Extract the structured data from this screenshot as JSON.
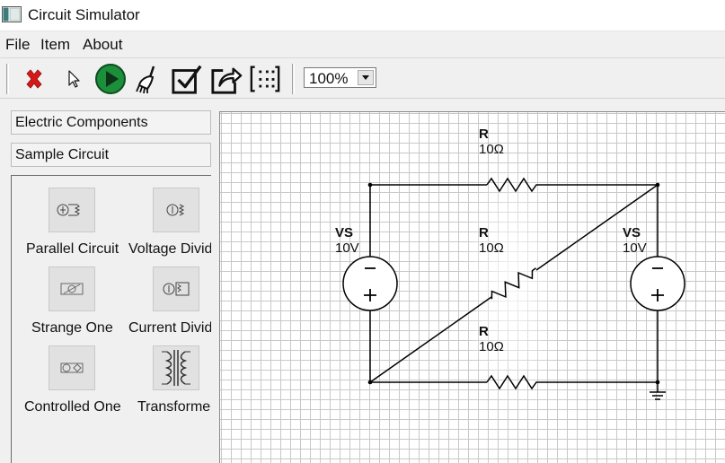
{
  "window": {
    "title": "Circuit Simulator"
  },
  "menu": {
    "items": [
      "File",
      "Item",
      "About"
    ]
  },
  "toolbar": {
    "zoom_value": "100%",
    "buttons": [
      "delete-icon",
      "pointer-icon",
      "run-icon",
      "broom-icon",
      "checkbox-icon",
      "export-icon",
      "grid-icon"
    ]
  },
  "sidebar": {
    "sections": [
      "Electric Components",
      "Sample Circuit"
    ],
    "samples": [
      {
        "label": "Parallel Circuit"
      },
      {
        "label": "Voltage Divid"
      },
      {
        "label": "Strange One"
      },
      {
        "label": "Current Divid"
      },
      {
        "label": "Controlled One"
      },
      {
        "label": "Transforme"
      }
    ]
  },
  "circuit": {
    "components": [
      {
        "name": "R",
        "value": "10Ω"
      },
      {
        "name": "R",
        "value": "10Ω"
      },
      {
        "name": "R",
        "value": "10Ω"
      },
      {
        "name": "VS",
        "value": "10V"
      },
      {
        "name": "VS",
        "value": "10V"
      }
    ]
  },
  "colors": {
    "wire": "#000000",
    "grid": "#c8c8c8",
    "delete": "#d81818",
    "run": "#1c8f3a"
  }
}
